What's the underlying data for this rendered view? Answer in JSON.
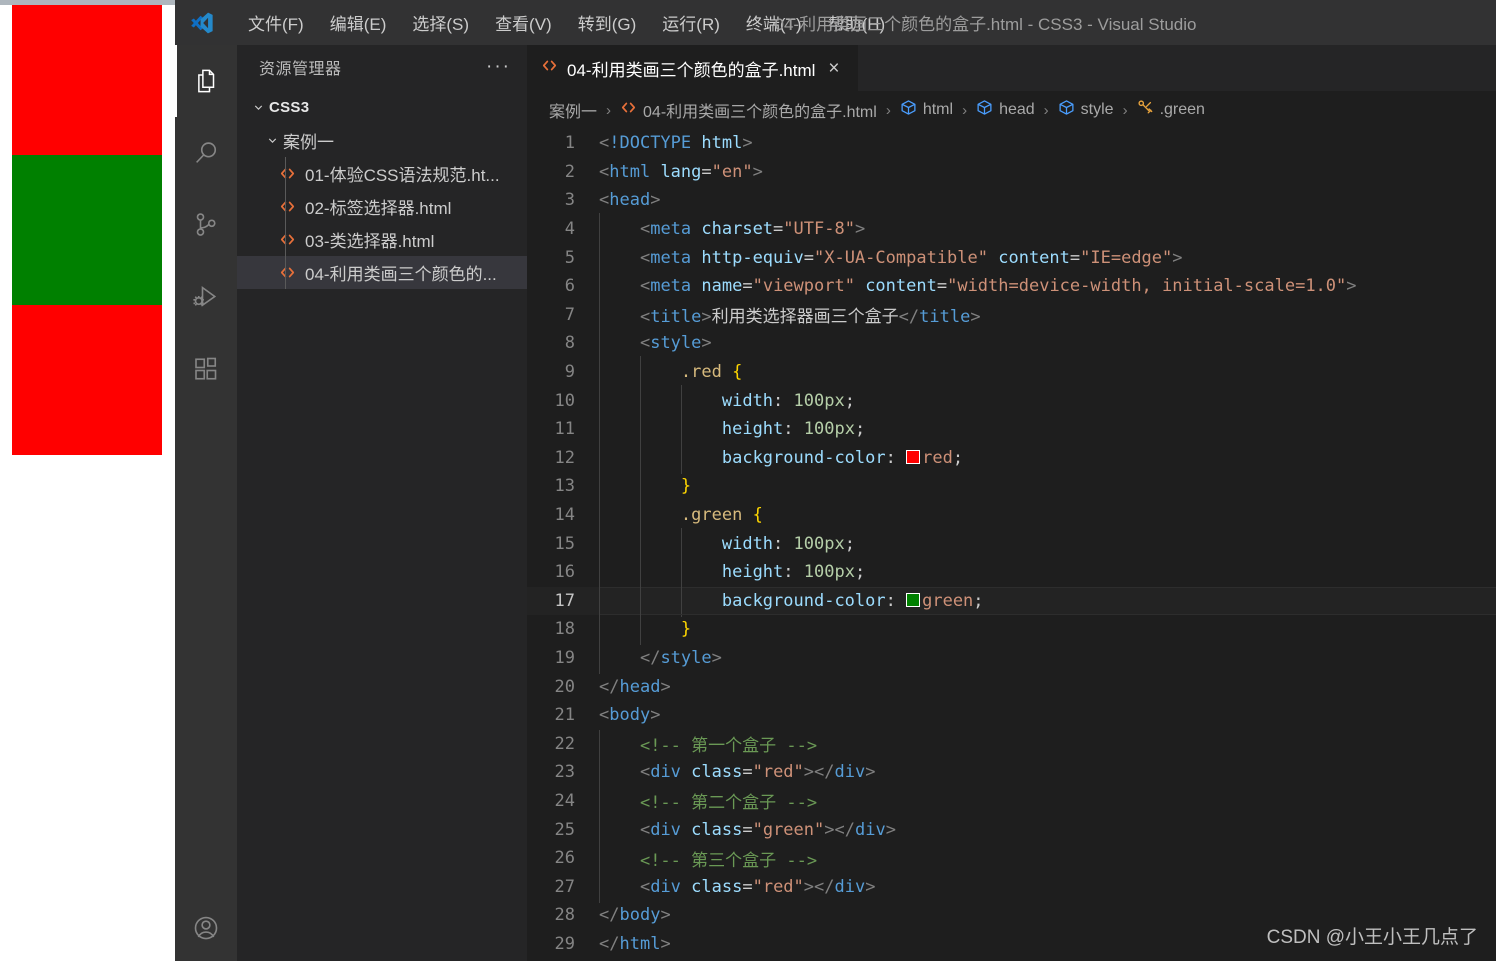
{
  "window": {
    "title": "04-利用类画三个颜色的盒子.html - CSS3 - Visual Studio",
    "logo_icon": "vscode-logo-icon"
  },
  "menu": {
    "items": [
      {
        "label": "文件(F)",
        "name": "menu-file"
      },
      {
        "label": "编辑(E)",
        "name": "menu-edit"
      },
      {
        "label": "选择(S)",
        "name": "menu-selection"
      },
      {
        "label": "查看(V)",
        "name": "menu-view"
      },
      {
        "label": "转到(G)",
        "name": "menu-go"
      },
      {
        "label": "运行(R)",
        "name": "menu-run"
      },
      {
        "label": "终端(T)",
        "name": "menu-terminal"
      },
      {
        "label": "帮助(H)",
        "name": "menu-help"
      }
    ]
  },
  "activity_bar": {
    "items": [
      {
        "icon": "files-explorer-icon",
        "active": true
      },
      {
        "icon": "search-icon",
        "active": false
      },
      {
        "icon": "source-control-icon",
        "active": false
      },
      {
        "icon": "run-and-debug-icon",
        "active": false
      },
      {
        "icon": "extensions-icon",
        "active": false
      }
    ],
    "bottom": {
      "icon": "account-icon"
    }
  },
  "sidebar": {
    "title": "资源管理器",
    "more_actions": "···",
    "tree": {
      "root": {
        "label": "CSS3",
        "expanded": true,
        "chevron": "chevron-down-icon"
      },
      "folder": {
        "label": "案例一",
        "expanded": true,
        "chevron": "chevron-down-icon"
      },
      "files": [
        {
          "label": "01-体验CSS语法规范.ht...",
          "icon": "html-file-icon",
          "selected": false
        },
        {
          "label": "02-标签选择器.html",
          "icon": "html-file-icon",
          "selected": false
        },
        {
          "label": "03-类选择器.html",
          "icon": "html-file-icon",
          "selected": false
        },
        {
          "label": "04-利用类画三个颜色的...",
          "icon": "html-file-icon",
          "selected": true
        }
      ]
    }
  },
  "editor": {
    "tab": {
      "label": "04-利用类画三个颜色的盒子.html",
      "icon": "html-file-icon",
      "close": "×",
      "active": true
    },
    "breadcrumbs": [
      {
        "text": "案例一",
        "icon": null
      },
      {
        "text": "04-利用类画三个颜色的盒子.html",
        "icon": "html-file-icon"
      },
      {
        "text": "html",
        "icon": "symbol-cube-icon"
      },
      {
        "text": "head",
        "icon": "symbol-cube-icon"
      },
      {
        "text": "style",
        "icon": "symbol-cube-icon"
      },
      {
        "text": ".green",
        "icon": "symbol-css-ruler-icon"
      }
    ],
    "separator": "›",
    "current_line": 17,
    "lines": [
      {
        "n": 1,
        "indent": 0,
        "tokens": [
          {
            "c": "t-punct",
            "t": "<"
          },
          {
            "c": "t-doctype",
            "t": "!DOCTYPE "
          },
          {
            "c": "t-attr",
            "t": "html"
          },
          {
            "c": "t-punct",
            "t": ">"
          }
        ]
      },
      {
        "n": 2,
        "indent": 0,
        "tokens": [
          {
            "c": "t-punct",
            "t": "<"
          },
          {
            "c": "t-tag",
            "t": "html "
          },
          {
            "c": "t-attr",
            "t": "lang"
          },
          {
            "c": "t-eq",
            "t": "="
          },
          {
            "c": "t-str",
            "t": "\"en\""
          },
          {
            "c": "t-punct",
            "t": ">"
          }
        ]
      },
      {
        "n": 3,
        "indent": 0,
        "tokens": [
          {
            "c": "t-punct",
            "t": "<"
          },
          {
            "c": "t-tag",
            "t": "head"
          },
          {
            "c": "t-punct",
            "t": ">"
          }
        ]
      },
      {
        "n": 4,
        "indent": 1,
        "tokens": [
          {
            "c": "t-punct",
            "t": "<"
          },
          {
            "c": "t-tag",
            "t": "meta "
          },
          {
            "c": "t-attr",
            "t": "charset"
          },
          {
            "c": "t-eq",
            "t": "="
          },
          {
            "c": "t-str",
            "t": "\"UTF-8\""
          },
          {
            "c": "t-punct",
            "t": ">"
          }
        ]
      },
      {
        "n": 5,
        "indent": 1,
        "tokens": [
          {
            "c": "t-punct",
            "t": "<"
          },
          {
            "c": "t-tag",
            "t": "meta "
          },
          {
            "c": "t-attr",
            "t": "http-equiv"
          },
          {
            "c": "t-eq",
            "t": "="
          },
          {
            "c": "t-str",
            "t": "\"X-UA-Compatible\" "
          },
          {
            "c": "t-attr",
            "t": "content"
          },
          {
            "c": "t-eq",
            "t": "="
          },
          {
            "c": "t-str",
            "t": "\"IE=edge\""
          },
          {
            "c": "t-punct",
            "t": ">"
          }
        ]
      },
      {
        "n": 6,
        "indent": 1,
        "tokens": [
          {
            "c": "t-punct",
            "t": "<"
          },
          {
            "c": "t-tag",
            "t": "meta "
          },
          {
            "c": "t-attr",
            "t": "name"
          },
          {
            "c": "t-eq",
            "t": "="
          },
          {
            "c": "t-str",
            "t": "\"viewport\" "
          },
          {
            "c": "t-attr",
            "t": "content"
          },
          {
            "c": "t-eq",
            "t": "="
          },
          {
            "c": "t-str",
            "t": "\"width=device-width, initial-scale=1.0\""
          },
          {
            "c": "t-punct",
            "t": ">"
          }
        ]
      },
      {
        "n": 7,
        "indent": 1,
        "tokens": [
          {
            "c": "t-punct",
            "t": "<"
          },
          {
            "c": "t-tag",
            "t": "title"
          },
          {
            "c": "t-punct",
            "t": ">"
          },
          {
            "c": "t-text",
            "t": "利用类选择器画三个盒子"
          },
          {
            "c": "t-punct",
            "t": "</"
          },
          {
            "c": "t-tag",
            "t": "title"
          },
          {
            "c": "t-punct",
            "t": ">"
          }
        ]
      },
      {
        "n": 8,
        "indent": 1,
        "tokens": [
          {
            "c": "t-punct",
            "t": "<"
          },
          {
            "c": "t-tag",
            "t": "style"
          },
          {
            "c": "t-punct",
            "t": ">"
          }
        ]
      },
      {
        "n": 9,
        "indent": 2,
        "tokens": [
          {
            "c": "t-sel",
            "t": ".red "
          },
          {
            "c": "t-brace",
            "t": "{"
          }
        ]
      },
      {
        "n": 10,
        "indent": 3,
        "tokens": [
          {
            "c": "t-prop",
            "t": "width"
          },
          {
            "c": "t-text",
            "t": ": "
          },
          {
            "c": "t-num",
            "t": "100px"
          },
          {
            "c": "t-text",
            "t": ";"
          }
        ]
      },
      {
        "n": 11,
        "indent": 3,
        "tokens": [
          {
            "c": "t-prop",
            "t": "height"
          },
          {
            "c": "t-text",
            "t": ": "
          },
          {
            "c": "t-num",
            "t": "100px"
          },
          {
            "c": "t-text",
            "t": ";"
          }
        ]
      },
      {
        "n": 12,
        "indent": 3,
        "tokens": [
          {
            "c": "t-prop",
            "t": "background-color"
          },
          {
            "c": "t-text",
            "t": ": "
          },
          {
            "c": "swatch",
            "t": "",
            "swatch": "#ff0000"
          },
          {
            "c": "t-val",
            "t": "red"
          },
          {
            "c": "t-text",
            "t": ";"
          }
        ]
      },
      {
        "n": 13,
        "indent": 2,
        "tokens": [
          {
            "c": "t-brace",
            "t": "}"
          }
        ]
      },
      {
        "n": 14,
        "indent": 2,
        "tokens": [
          {
            "c": "t-sel",
            "t": ".green "
          },
          {
            "c": "t-brace",
            "t": "{"
          }
        ]
      },
      {
        "n": 15,
        "indent": 3,
        "tokens": [
          {
            "c": "t-prop",
            "t": "width"
          },
          {
            "c": "t-text",
            "t": ": "
          },
          {
            "c": "t-num",
            "t": "100px"
          },
          {
            "c": "t-text",
            "t": ";"
          }
        ]
      },
      {
        "n": 16,
        "indent": 3,
        "tokens": [
          {
            "c": "t-prop",
            "t": "height"
          },
          {
            "c": "t-text",
            "t": ": "
          },
          {
            "c": "t-num",
            "t": "100px"
          },
          {
            "c": "t-text",
            "t": ";"
          }
        ]
      },
      {
        "n": 17,
        "indent": 3,
        "tokens": [
          {
            "c": "t-prop",
            "t": "background-color"
          },
          {
            "c": "t-text",
            "t": ": "
          },
          {
            "c": "swatch",
            "t": "",
            "swatch": "#008000"
          },
          {
            "c": "t-val",
            "t": "green"
          },
          {
            "c": "t-text",
            "t": ";"
          }
        ]
      },
      {
        "n": 18,
        "indent": 2,
        "tokens": [
          {
            "c": "t-brace",
            "t": "}"
          }
        ]
      },
      {
        "n": 19,
        "indent": 1,
        "tokens": [
          {
            "c": "t-punct",
            "t": "</"
          },
          {
            "c": "t-tag",
            "t": "style"
          },
          {
            "c": "t-punct",
            "t": ">"
          }
        ]
      },
      {
        "n": 20,
        "indent": 0,
        "tokens": [
          {
            "c": "t-punct",
            "t": "</"
          },
          {
            "c": "t-tag",
            "t": "head"
          },
          {
            "c": "t-punct",
            "t": ">"
          }
        ]
      },
      {
        "n": 21,
        "indent": 0,
        "tokens": [
          {
            "c": "t-punct",
            "t": "<"
          },
          {
            "c": "t-tag",
            "t": "body"
          },
          {
            "c": "t-punct",
            "t": ">"
          }
        ]
      },
      {
        "n": 22,
        "indent": 1,
        "tokens": [
          {
            "c": "t-comment",
            "t": "<!-- 第一个盒子 -->"
          }
        ]
      },
      {
        "n": 23,
        "indent": 1,
        "tokens": [
          {
            "c": "t-punct",
            "t": "<"
          },
          {
            "c": "t-tag",
            "t": "div "
          },
          {
            "c": "t-attr",
            "t": "class"
          },
          {
            "c": "t-eq",
            "t": "="
          },
          {
            "c": "t-str",
            "t": "\"red\""
          },
          {
            "c": "t-punct",
            "t": ">"
          },
          {
            "c": "t-punct",
            "t": "</"
          },
          {
            "c": "t-tag",
            "t": "div"
          },
          {
            "c": "t-punct",
            "t": ">"
          }
        ]
      },
      {
        "n": 24,
        "indent": 1,
        "tokens": [
          {
            "c": "t-comment",
            "t": "<!-- 第二个盒子 -->"
          }
        ]
      },
      {
        "n": 25,
        "indent": 1,
        "tokens": [
          {
            "c": "t-punct",
            "t": "<"
          },
          {
            "c": "t-tag",
            "t": "div "
          },
          {
            "c": "t-attr",
            "t": "class"
          },
          {
            "c": "t-eq",
            "t": "="
          },
          {
            "c": "t-str",
            "t": "\"green\""
          },
          {
            "c": "t-punct",
            "t": ">"
          },
          {
            "c": "t-punct",
            "t": "</"
          },
          {
            "c": "t-tag",
            "t": "div"
          },
          {
            "c": "t-punct",
            "t": ">"
          }
        ]
      },
      {
        "n": 26,
        "indent": 1,
        "tokens": [
          {
            "c": "t-comment",
            "t": "<!-- 第三个盒子 -->"
          }
        ]
      },
      {
        "n": 27,
        "indent": 1,
        "tokens": [
          {
            "c": "t-punct",
            "t": "<"
          },
          {
            "c": "t-tag",
            "t": "div "
          },
          {
            "c": "t-attr",
            "t": "class"
          },
          {
            "c": "t-eq",
            "t": "="
          },
          {
            "c": "t-str",
            "t": "\"red\""
          },
          {
            "c": "t-punct",
            "t": ">"
          },
          {
            "c": "t-punct",
            "t": "</"
          },
          {
            "c": "t-tag",
            "t": "div"
          },
          {
            "c": "t-punct",
            "t": ">"
          }
        ]
      },
      {
        "n": 28,
        "indent": 0,
        "tokens": [
          {
            "c": "t-punct",
            "t": "</"
          },
          {
            "c": "t-tag",
            "t": "body"
          },
          {
            "c": "t-punct",
            "t": ">"
          }
        ]
      },
      {
        "n": 29,
        "indent": 0,
        "tokens": [
          {
            "c": "t-punct",
            "t": "</"
          },
          {
            "c": "t-tag",
            "t": "html"
          },
          {
            "c": "t-punct",
            "t": ">"
          }
        ]
      }
    ]
  },
  "browser_preview": {
    "boxes": [
      {
        "class": "red",
        "color": "#ff0000"
      },
      {
        "class": "green",
        "color": "#008000"
      },
      {
        "class": "red",
        "color": "#ff0000"
      }
    ]
  },
  "watermark": "CSDN @小王小王几点了",
  "colors": {
    "titlebar_bg": "#323233",
    "activitybar_bg": "#333333",
    "sidebar_bg": "#252526",
    "editor_bg": "#1e1e1e",
    "selection_bg": "#37373d",
    "accent_blue": "#007acc"
  }
}
